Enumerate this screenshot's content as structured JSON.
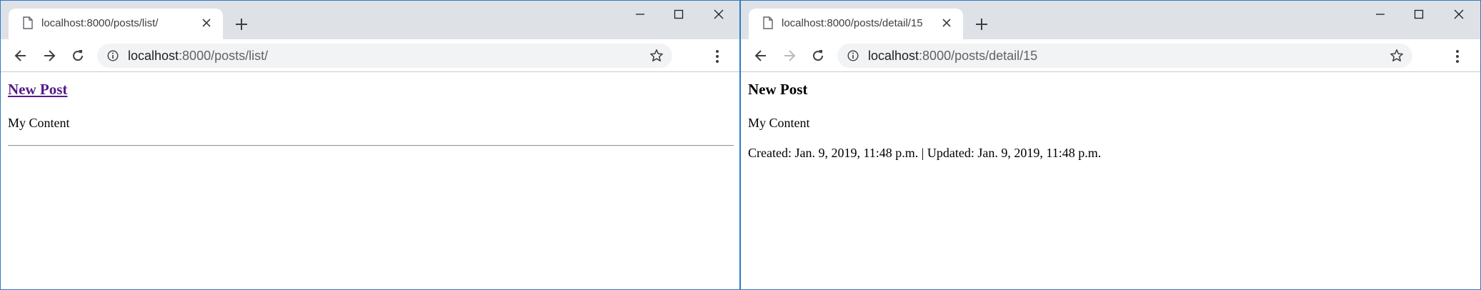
{
  "windows": [
    {
      "tab": {
        "title": "localhost:8000/posts/list/"
      },
      "address": {
        "host": "localhost",
        "path": ":8000/posts/list/"
      },
      "page": {
        "heading": "New Post",
        "heading_is_link": true,
        "content": "My Content"
      }
    },
    {
      "tab": {
        "title": "localhost:8000/posts/detail/15"
      },
      "address": {
        "host": "localhost",
        "path": ":8000/posts/detail/15"
      },
      "page": {
        "heading": "New Post",
        "heading_is_link": false,
        "content": "My Content",
        "meta": "Created: Jan. 9, 2019, 11:48 p.m. | Updated: Jan. 9, 2019, 11:48 p.m."
      }
    }
  ],
  "colors": {
    "tabstrip": "#dee1e6",
    "window_border": "#2b7bc3",
    "visited_link": "#551a8b",
    "omnibox": "#f1f3f4"
  },
  "icons": [
    "document-icon",
    "close-icon",
    "plus-icon",
    "minimize-icon",
    "maximize-icon",
    "back-arrow-icon",
    "forward-arrow-icon",
    "reload-icon",
    "info-icon",
    "star-icon",
    "kebab-menu-icon"
  ]
}
